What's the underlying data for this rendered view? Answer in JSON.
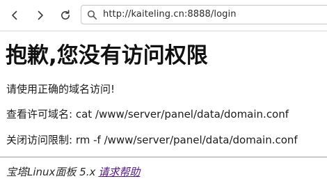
{
  "browser": {
    "url": "http://kaiteling.cn:8888/login"
  },
  "page": {
    "heading": "抱歉,您没有访问权限",
    "line1": "请使用正确的域名访问!",
    "line2": "查看许可域名: cat /www/server/panel/data/domain.conf",
    "line3": "关闭访问限制: rm -f /www/server/panel/data/domain.conf",
    "footer_text": "宝塔Linux面板 5.x",
    "footer_link": "请求帮助"
  },
  "colors": {
    "visited_link": "#551a8b"
  }
}
